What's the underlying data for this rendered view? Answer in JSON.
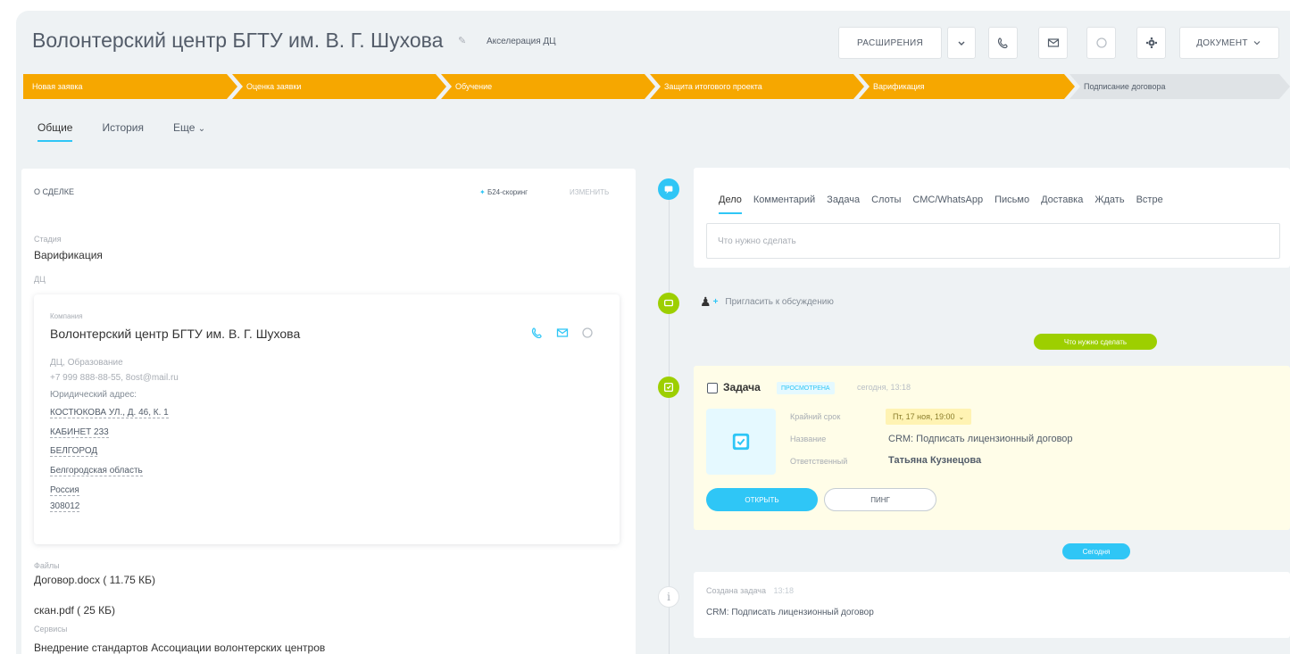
{
  "header": {
    "title": "Волонтерский центр БГТУ им. В. Г. Шухова",
    "funnel": "Акселерация ДЦ",
    "extensions_label": "РАСШИРЕНИЯ",
    "document_label": "ДОКУМЕНТ"
  },
  "stages": [
    {
      "label": "Новая заявка",
      "done": true
    },
    {
      "label": "Оценка заявки",
      "done": true
    },
    {
      "label": "Обучение",
      "done": true
    },
    {
      "label": "Защита итогового проекта",
      "done": true
    },
    {
      "label": "Варификация",
      "done": true
    },
    {
      "label": "Подписание договора",
      "done": false
    }
  ],
  "tabs": [
    "Общие",
    "История",
    "Еще"
  ],
  "deal": {
    "section_title": "О СДЕЛКЕ",
    "bitrix_label": "Б24-скоринг",
    "change_label": "изменить",
    "stage_label": "Стадия",
    "stage_value": "Варификация",
    "dc_label": "ДЦ",
    "company": {
      "label": "Компания",
      "name": "Волонтерский центр БГТУ им. В. Г. Шухова",
      "type": "ДЦ, Образование",
      "contacts": "+7 999 888-88-55, 8ost@mail.ru",
      "address_label": "Юридический адрес:",
      "address_lines": [
        "КОСТЮКОВА УЛ., Д. 46, К. 1",
        "КАБИНЕТ 233",
        "БЕЛГОРОД",
        "Белгородская область",
        "Россия",
        "308012"
      ]
    },
    "files_label": "Файлы",
    "files": [
      "Договор.docx ( 11.75 КБ)",
      "скан.pdf ( 25 КБ)"
    ],
    "services_label": "Сервисы",
    "services_value": "Внедрение стандартов Ассоциации волонтерских центров"
  },
  "activity": {
    "tabs": [
      "Дело",
      "Комментарий",
      "Задача",
      "Слоты",
      "СМС/WhatsApp",
      "Письмо",
      "Доставка",
      "Ждать",
      "Встре"
    ],
    "input_placeholder": "Что нужно сделать",
    "invite": "Пригласить к обсуждению",
    "todo_pill": "Что нужно сделать",
    "today_pill": "Сегодня"
  },
  "task": {
    "title": "Задача",
    "badge": "просмотрена",
    "time": "сегодня, 13:18",
    "deadline_label": "Крайний срок",
    "deadline_value": "Пт, 17 ноя, 19:00",
    "name_label": "Название",
    "name_value": "CRM: Подписать лицензионный договор",
    "resp_label": "Ответственный",
    "resp_value": "Татьяна Кузнецова",
    "open_label": "открыть",
    "ping_label": "пинг"
  },
  "history": {
    "title": "Создана задача",
    "time": "13:18",
    "text": "CRM: Подписать лицензионный договор"
  },
  "colors": {
    "stage_done": "#f6a700",
    "stage_todo": "#dfe3e6",
    "accent_blue": "#2fc6f6",
    "accent_green": "#9dcf00"
  }
}
